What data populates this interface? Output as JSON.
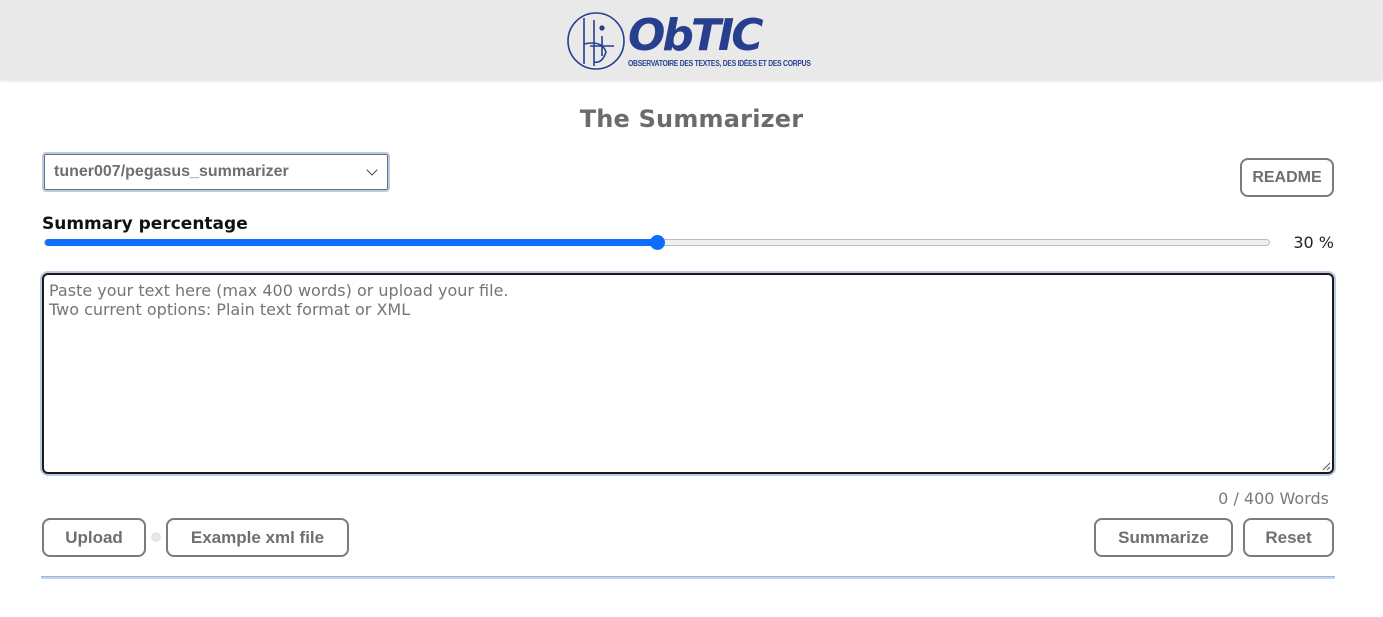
{
  "header": {
    "logo_text": "ObTIC",
    "logo_subtitle": "OBSERVATOIRE DES TEXTES, DES IDÉES ET DES CORPUS",
    "brand_color": "#273f8e"
  },
  "page_title": "The Summarizer",
  "model_select": {
    "selected": "tuner007/pegasus_summarizer",
    "icon": "chevron-down-icon"
  },
  "readme_label": "README",
  "summary": {
    "label": "Summary percentage",
    "value": 30,
    "min": 0,
    "max": 100,
    "slider_fraction": 0.5,
    "value_text": "30 %",
    "accent_color": "#0d6efd"
  },
  "input": {
    "placeholder": "Paste your text here (max 400 words) or upload your file.\nTwo current options: Plain text format or XML",
    "value": ""
  },
  "word_count": "0 / 400 Words",
  "actions": {
    "upload_label": "Upload",
    "example_label": "Example xml file",
    "summarize_label": "Summarize",
    "reset_label": "Reset"
  }
}
